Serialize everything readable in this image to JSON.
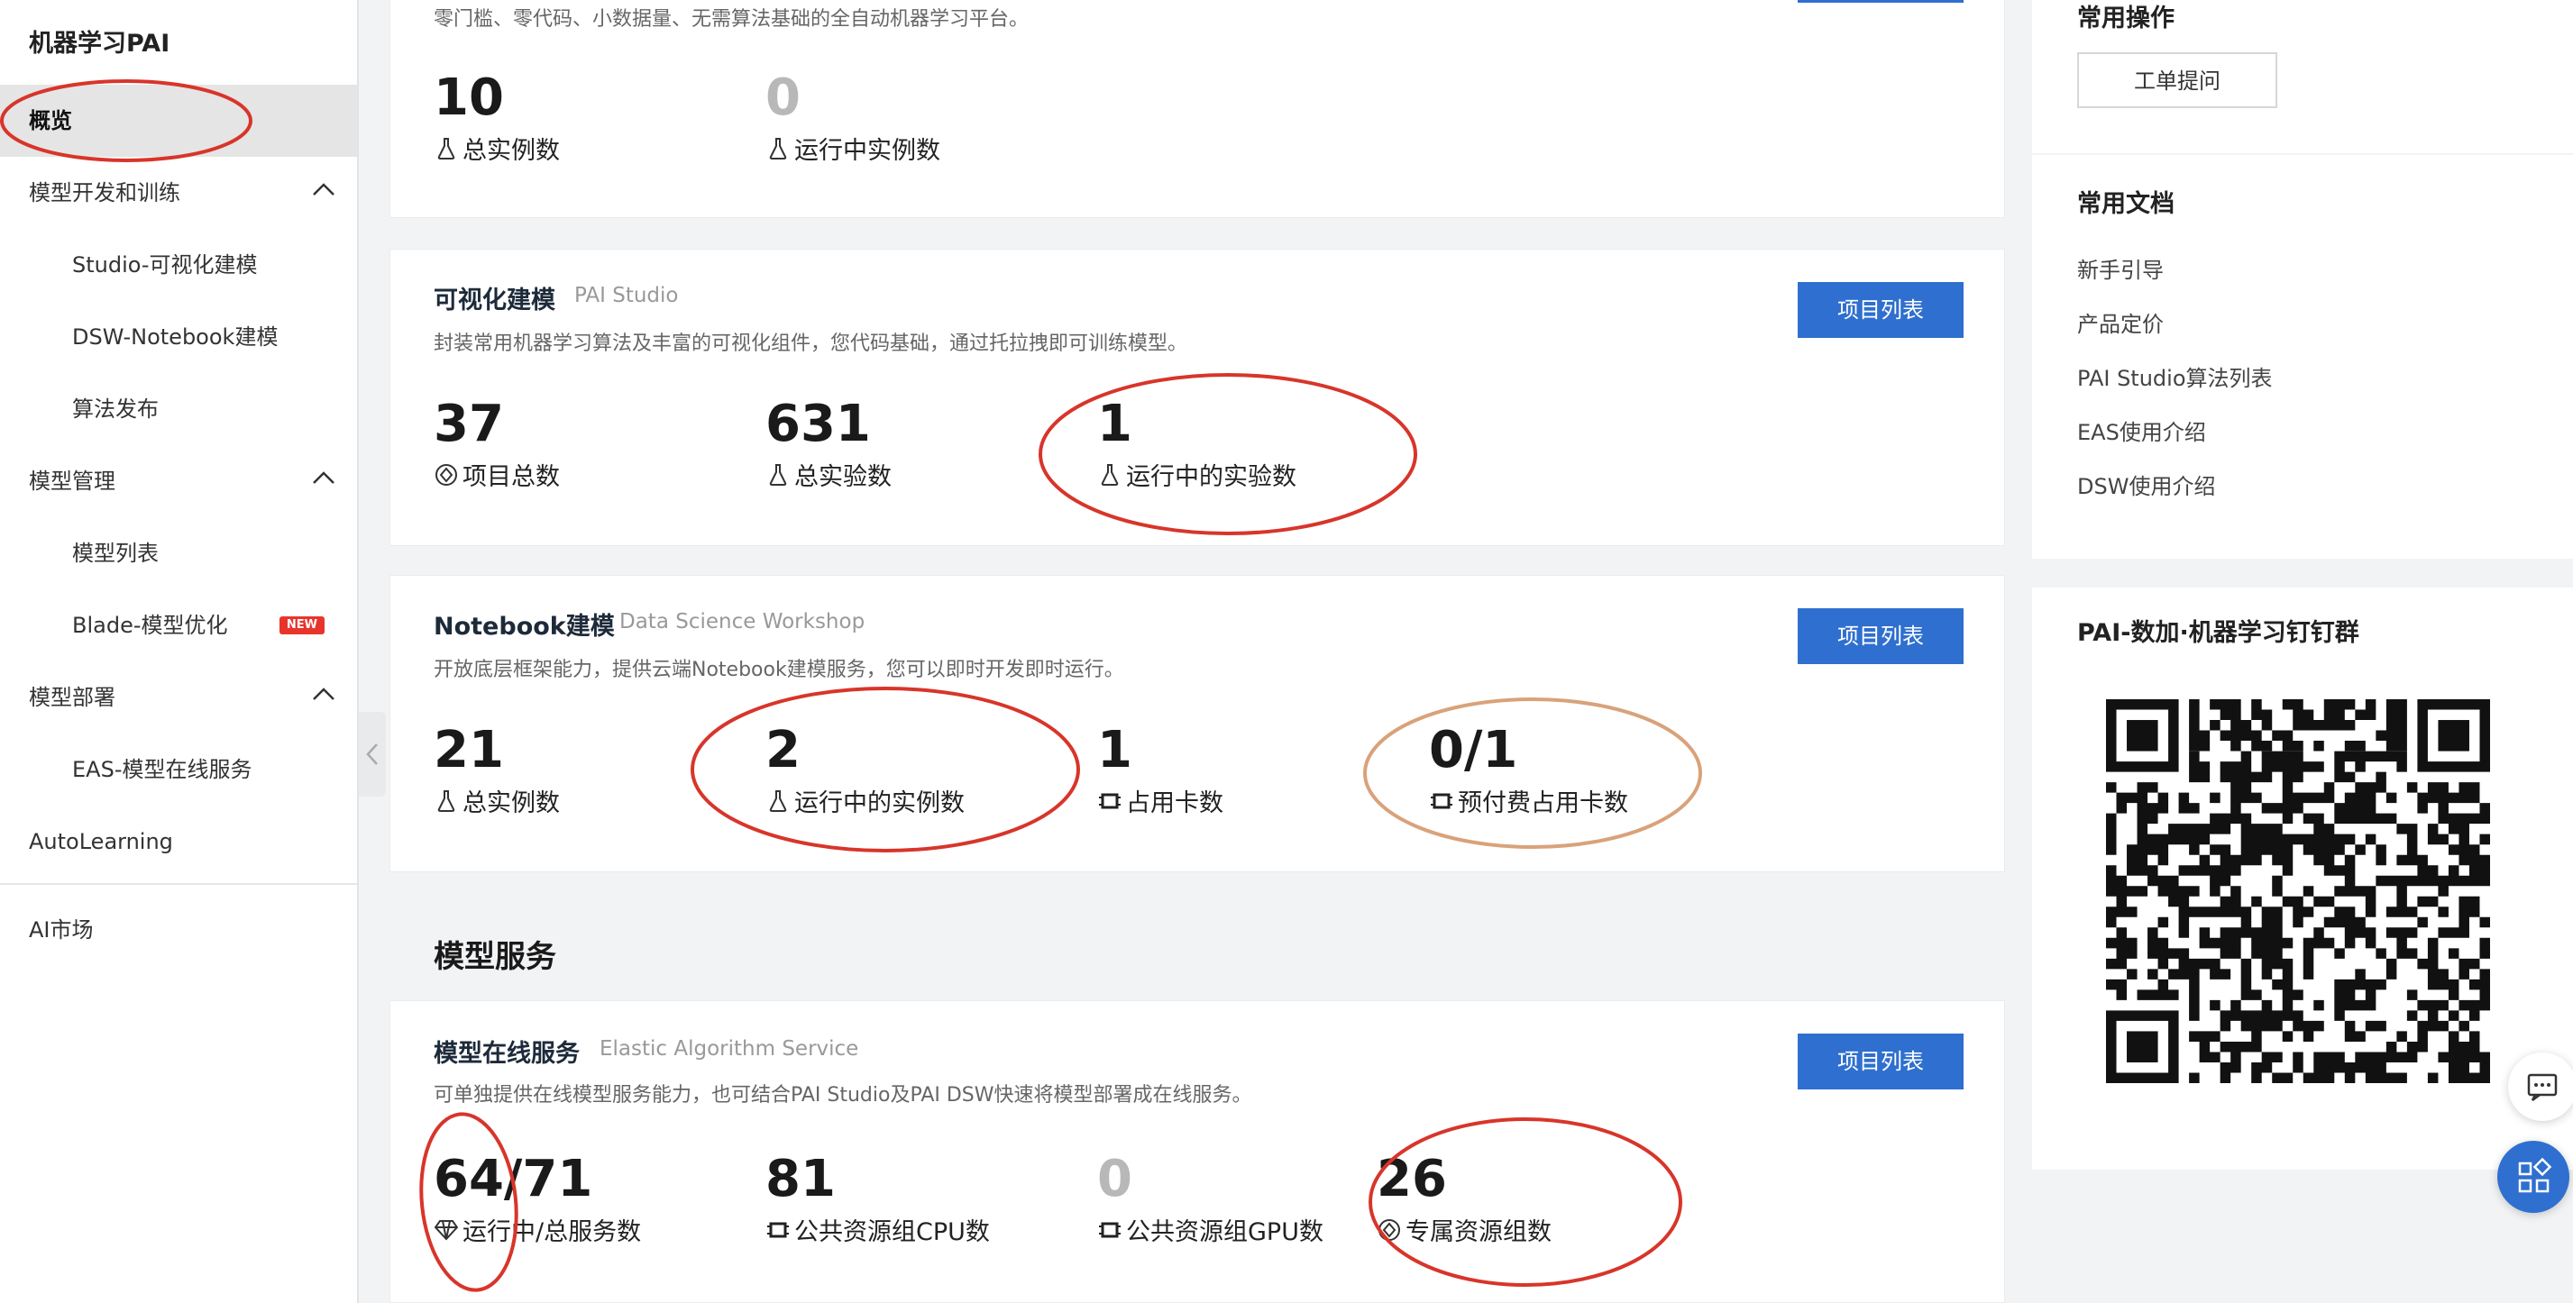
{
  "sidebar": {
    "app_title": "机器学习PAI",
    "overview": "概览",
    "model_dev": "模型开发和训练",
    "studio": "Studio-可视化建模",
    "dsw": "DSW-Notebook建模",
    "algo_publish": "算法发布",
    "model_mgmt": "模型管理",
    "model_list": "模型列表",
    "blade": "Blade-模型优化",
    "new_badge": "NEW",
    "model_deploy": "模型部署",
    "eas": "EAS-模型在线服务",
    "autolearning": "AutoLearning",
    "ai_market": "AI市场"
  },
  "auto_card": {
    "desc": "零门槛、零代码、小数据量、无需算法基础的全自动机器学习平台。",
    "stats": [
      {
        "value": "10",
        "label": "总实例数"
      },
      {
        "value": "0",
        "label": "运行中实例数"
      }
    ]
  },
  "studio_card": {
    "title": "可视化建模",
    "subtitle": "PAI Studio",
    "desc": "封装常用机器学习算法及丰富的可视化组件，您代码基础，通过托拉拽即可训练模型。",
    "button": "项目列表",
    "stats": [
      {
        "value": "37",
        "label": "项目总数"
      },
      {
        "value": "631",
        "label": "总实验数"
      },
      {
        "value": "1",
        "label": "运行中的实验数"
      }
    ]
  },
  "notebook_card": {
    "title": "Notebook建模",
    "subtitle": "Data Science Workshop",
    "desc": "开放底层框架能力，提供云端Notebook建模服务，您可以即时开发即时运行。",
    "button": "项目列表",
    "stats": [
      {
        "value": "21",
        "label": "总实例数"
      },
      {
        "value": "2",
        "label": "运行中的实例数"
      },
      {
        "value": "1",
        "label": "占用卡数"
      },
      {
        "value": "0/1",
        "label": "预付费占用卡数"
      }
    ]
  },
  "section_title": "模型服务",
  "eas_card": {
    "title": "模型在线服务",
    "subtitle": "Elastic Algorithm Service",
    "desc": "可单独提供在线模型服务能力，也可结合PAI Studio及PAI DSW快速将模型部署成在线服务。",
    "button": "项目列表",
    "stats": [
      {
        "value": "64/71",
        "label": "运行中/总服务数"
      },
      {
        "value": "81",
        "label": "公共资源组CPU数"
      },
      {
        "value": "0",
        "label": "公共资源组GPU数"
      },
      {
        "value": "26",
        "label": "专属资源组数"
      }
    ]
  },
  "right_panel": {
    "ops_title": "常用操作",
    "ticket_button": "工单提问",
    "docs_title": "常用文档",
    "docs": [
      "新手引导",
      "产品定价",
      "PAI Studio算法列表",
      "EAS使用介绍",
      "DSW使用介绍"
    ],
    "group_title": "PAI-数加·机器学习钉钉群"
  },
  "colors": {
    "primary": "#2f6fcf",
    "badge_new": "#e8352b",
    "annotation_red": "#d8352a",
    "annotation_orange": "#d9a27a"
  }
}
